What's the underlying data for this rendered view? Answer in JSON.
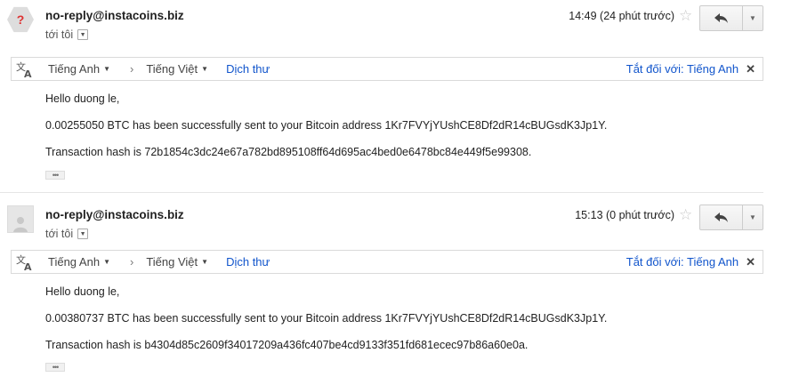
{
  "emails": [
    {
      "sender": "no-reply@instacoins.biz",
      "to_label": "tới tôi",
      "time": "14:49 (24 phút trước)",
      "avatar_glyph": "?",
      "translate": {
        "from_lang": "Tiếng Anh",
        "to_lang": "Tiếng Việt",
        "translate_link": "Dịch thư",
        "turn_off": "Tắt đối với: Tiếng Anh"
      },
      "body": [
        "Hello duong le,",
        "0.00255050 BTC has been successfully sent to your Bitcoin address 1Kr7FVYjYUshCE8Df2dR14cBUGsdK3Jp1Y.",
        "Transaction hash is 72b1854c3dc24e67a782bd895108ff64d695ac4bed0e6478bc84e449f5e99308."
      ]
    },
    {
      "sender": "no-reply@instacoins.biz",
      "to_label": "tới tôi",
      "time": "15:13 (0 phút trước)",
      "translate": {
        "from_lang": "Tiếng Anh",
        "to_lang": "Tiếng Việt",
        "translate_link": "Dịch thư",
        "turn_off": "Tắt đối với: Tiếng Anh"
      },
      "body": [
        "Hello duong le,",
        "0.00380737 BTC has been successfully sent to your Bitcoin address 1Kr7FVYjYUshCE8Df2dR14cBUGsdK3Jp1Y.",
        "Transaction hash is b4304d85c2609f34017209a436fc407be4cd9133f351fd681ecec97b86a60e0a."
      ]
    }
  ],
  "colors": {
    "link": "#1155cc",
    "avatar_warning": "#dd3333"
  },
  "icons": [
    "translate-icon",
    "reply-icon",
    "star-icon",
    "close-icon",
    "dropdown-arrow-icon"
  ]
}
